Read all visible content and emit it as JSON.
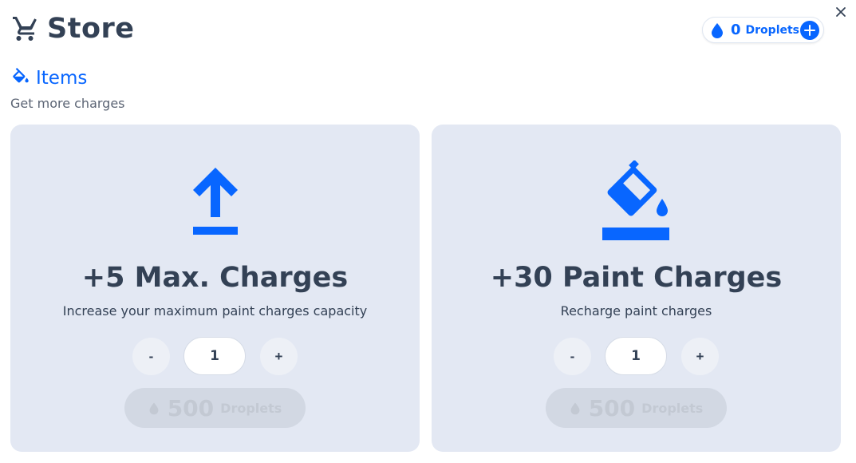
{
  "header": {
    "title": "Store",
    "icon": "cart-icon"
  },
  "balance": {
    "count": "0",
    "label": "Droplets",
    "icon": "droplet-icon",
    "add_icon": "plus-icon"
  },
  "close": {
    "icon": "close-icon"
  },
  "section": {
    "title": "Items",
    "subtitle": "Get more charges",
    "icon": "paint-bucket-icon"
  },
  "colors": {
    "accent": "#0866ff",
    "text": "#334155",
    "card_bg": "#e3e8f3",
    "disabled": "#c3c9d3"
  },
  "items": [
    {
      "title": "+5 Max. Charges",
      "description": "Increase your maximum paint charges capacity",
      "icon": "upload-arrow-icon",
      "minus": "-",
      "quantity": "1",
      "plus": "+",
      "price": "500",
      "price_label": "Droplets"
    },
    {
      "title": "+30 Paint Charges",
      "description": "Recharge paint charges",
      "icon": "paint-bucket-icon",
      "minus": "-",
      "quantity": "1",
      "plus": "+",
      "price": "500",
      "price_label": "Droplets"
    }
  ]
}
